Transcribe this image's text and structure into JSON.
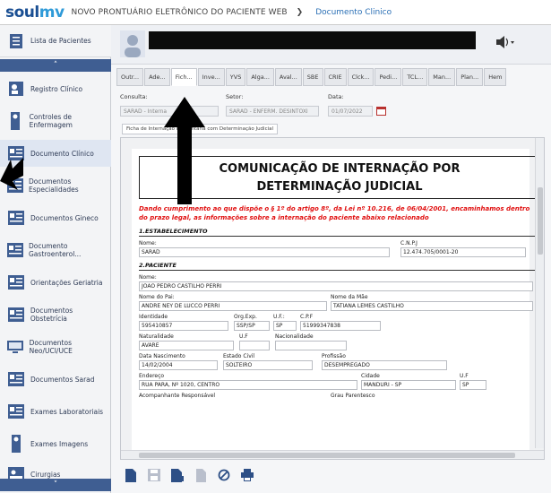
{
  "header": {
    "logo_soul": "soul",
    "logo_mv": "mv",
    "app_title": "NOVO PRONTUÁRIO ELETRÔNICO DO PACIENTE WEB",
    "chevron": "❯",
    "doc_link": "Documento Clinico"
  },
  "sidebar": {
    "top_label": "Lista de Pacientes",
    "scroll_up": "˄",
    "scroll_down": "˅",
    "items": [
      {
        "label": "Registro Clínico"
      },
      {
        "label": "Controles de Enfermagem"
      },
      {
        "label": "Documento Clínico"
      },
      {
        "label": "Documentos Especialidades"
      },
      {
        "label": "Documentos Gineco"
      },
      {
        "label": "Documento Gastroenterol..."
      },
      {
        "label": "Orientações Geriatria"
      },
      {
        "label": "Documentos Obstetrícia"
      },
      {
        "label": "Documentos Neo/UCI/UCE"
      },
      {
        "label": "Documentos Sarad"
      },
      {
        "label": "Exames Laboratoriais"
      },
      {
        "label": "Exames Imagens"
      },
      {
        "label": "Cirurgias"
      }
    ]
  },
  "tabs": [
    "Outr...",
    "Ade...",
    "Fich...",
    "Inve...",
    "YVS",
    "Alga...",
    "Aval...",
    "SBE",
    "CRIE",
    "Clck...",
    "Pedi...",
    "TCL...",
    "Man...",
    "Plan...",
    "Hem"
  ],
  "fields": {
    "consulta_label": "Consulta:",
    "consulta_value": "SARAD - Interna",
    "setor_label": "Setor:",
    "setor_value": "SARAD - ENFERM. DESINTOXI",
    "data_label": "Data:",
    "data_value": "01/07/2022"
  },
  "subtab": "Ficha de Internação Involuntária com Determinação Judicial",
  "doc": {
    "title_line1": "COMUNICAÇÃO DE INTERNAÇÃO POR",
    "title_line2": "DETERMINAÇÃO JUDICIAL",
    "intro": "Dando cumprimento ao que dispõe o § 1º do artigo 8º, da Lei nº 10.216, de 06/04/2001, encaminhamos dentro do prazo legal, as informações sobre a internação do paciente abaixo relacionado",
    "sec1": "1.ESTABELECIMENTO",
    "nome_label": "Nome:",
    "nome_value": "SARAD",
    "cnpj_label": "C.N.P.J",
    "cnpj_value": "12.474.705/0001-20",
    "sec2": "2.PACIENTE",
    "pac_nome_label": "Nome:",
    "pac_nome_value": "JOAO PEDRO CASTILHO PERRI",
    "pai_label": "Nome do Pai:",
    "pai_value": "ANDRE NEY DE LUCCO PERRI",
    "mae_label": "Nome da Mãe",
    "mae_value": "TATIANA LEMES CASTILHO",
    "ident_label": "Identidade",
    "ident_value": "595410857",
    "org_label": "Org.Exp.",
    "org_value": "SSP/SP",
    "uf_label": "U.F.:",
    "uf_value": "SP",
    "cpf_label": "C.P.F",
    "cpf_value": "51999347838",
    "nat_label": "Naturalidade",
    "nat_value": "AVARE",
    "uf2_label": "U.F",
    "nac_label": "Nacionalidade",
    "nasc_label": "Data Nascimento",
    "nasc_value": "14/02/2004",
    "civil_label": "Estado Civil",
    "civil_value": "SOLTEIRO",
    "prof_label": "Profissão",
    "prof_value": "DESEMPREGADO",
    "end_label": "Endereço",
    "end_value": "RUA PARA, Nº 1020, CENTRO",
    "cidade_label": "Cidade",
    "cidade_value": "MANDURI - SP",
    "uf3_label": "U.F",
    "uf3_value": "SP",
    "acomp_label": "Acompanhante Responsável",
    "grau_label": "Grau Parentesco"
  }
}
